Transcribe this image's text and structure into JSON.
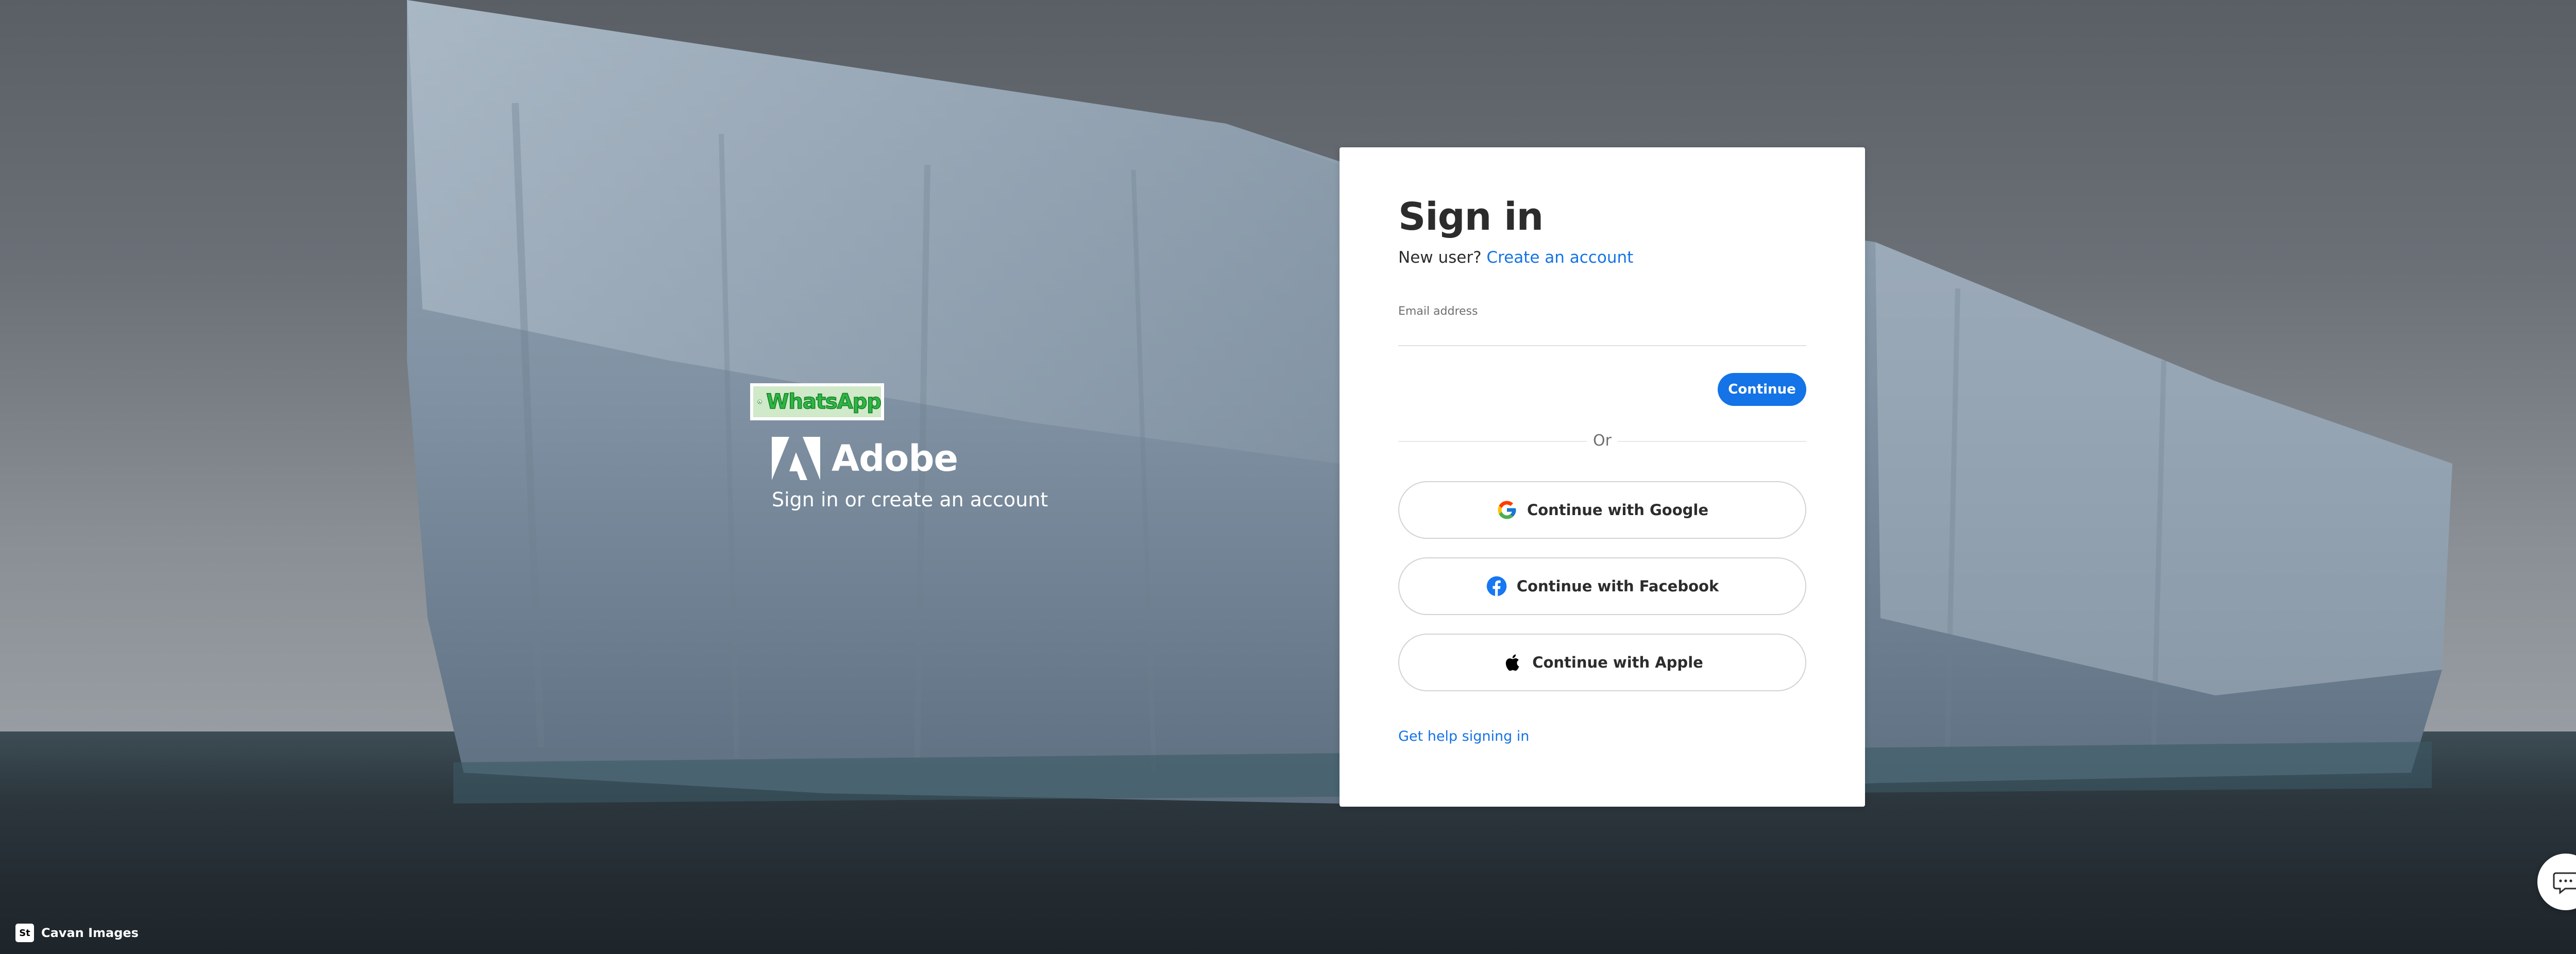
{
  "brand": {
    "name": "Adobe",
    "tagline": "Sign in or create an account",
    "sticker_text": "WhatsApp"
  },
  "card": {
    "title": "Sign in",
    "new_user_prompt": "New user?",
    "create_account_link": "Create an account",
    "email_label": "Email address",
    "email_value": "",
    "continue_label": "Continue",
    "divider_text": "Or",
    "social": {
      "google": "Continue with Google",
      "facebook": "Continue with Facebook",
      "apple": "Continue with Apple"
    },
    "help_link": "Get help signing in"
  },
  "credit": {
    "badge": "St",
    "text": "Cavan Images"
  },
  "colors": {
    "accent": "#1473e6",
    "card_background": "#ffffff",
    "text_primary": "#2c2c2c",
    "facebook_blue": "#1877f2",
    "whatsapp_green": "#2fb544"
  },
  "icons": {
    "google": "google-icon",
    "facebook": "facebook-icon",
    "apple": "apple-icon",
    "chat": "chat-icon",
    "brand": "adobe-logo-icon",
    "sticker": "whatsapp-icon"
  }
}
